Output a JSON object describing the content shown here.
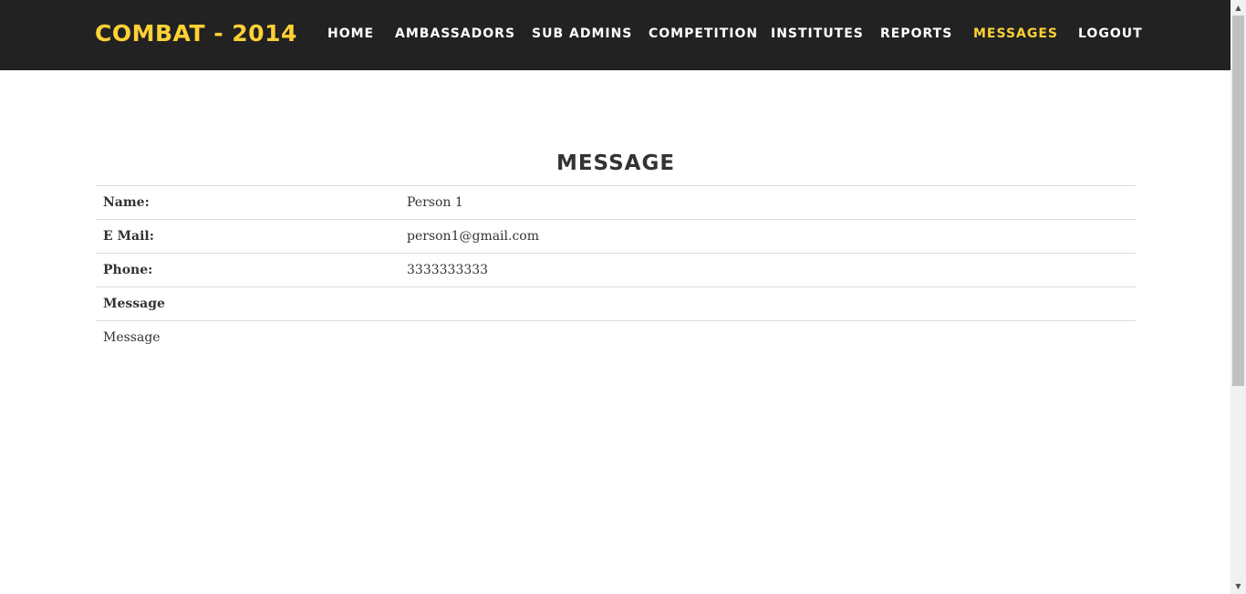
{
  "header": {
    "brand": "Combat - 2014",
    "nav": [
      {
        "label": "Home",
        "active": false
      },
      {
        "label": "Ambassadors",
        "active": false
      },
      {
        "label": "Sub Admins",
        "active": false
      },
      {
        "label": "Competition",
        "active": false
      },
      {
        "label": "Institutes",
        "active": false
      },
      {
        "label": "Reports",
        "active": false
      },
      {
        "label": "Messages",
        "active": true
      },
      {
        "label": "Logout",
        "active": false
      }
    ]
  },
  "main": {
    "title": "Message",
    "fields": [
      {
        "label": "Name:",
        "value": "Person 1"
      },
      {
        "label": "E Mail:",
        "value": "person1@gmail.com"
      },
      {
        "label": "Phone:",
        "value": "3333333333"
      }
    ],
    "message_label": "Message",
    "message_body": "Message"
  },
  "colors": {
    "navbar_bg": "#222222",
    "accent": "#fed136",
    "nav_text": "#ffffff",
    "body_text": "#333333",
    "row_border": "#dddddd"
  },
  "icons": {
    "scroll_up": "scroll-up-arrow-icon",
    "scroll_down": "scroll-down-arrow-icon"
  }
}
